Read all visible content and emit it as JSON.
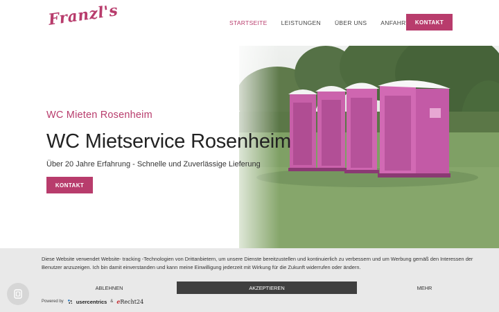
{
  "header": {
    "logo_text": "Franzl's",
    "nav": [
      "STARTSEITE",
      "LEISTUNGEN",
      "ÜBER UNS",
      "ANFAHRT"
    ],
    "cta": "KONTAKT"
  },
  "hero": {
    "subtitle": "WC Mieten Rosenheim",
    "title": "WC Mietservice Rosenheim",
    "description": "Über 20 Jahre Erfahrung - Schnelle und Zuverlässige Lieferung",
    "button": "KONTAKT"
  },
  "cookie": {
    "text": "Diese Website verwendet Website- tracking -Technologien von Drittanbietern, um unsere Dienste bereitzustellen und kontinuierlich zu verbessern und um Werbung gemäß den Interessen der Benutzer anzuzeigen. Ich bin damit einverstanden und kann meine Einwilligung jederzeit mit Wirkung für die Zukunft widerrufen oder ändern.",
    "deny": "ABLEHNEN",
    "accept": "AKZEPTIEREN",
    "more": "MEHR",
    "powered_by": "Powered by",
    "provider": "usercentrics",
    "ampersand": "&",
    "partner_e": "e",
    "partner_rest": "Recht24"
  },
  "colors": {
    "brand": "#b83c6c",
    "accept_bg": "#3f3f3f",
    "banner_bg": "#e9e9e9"
  },
  "icons": [
    "fingerprint-icon",
    "usercentrics-logo-icon"
  ]
}
